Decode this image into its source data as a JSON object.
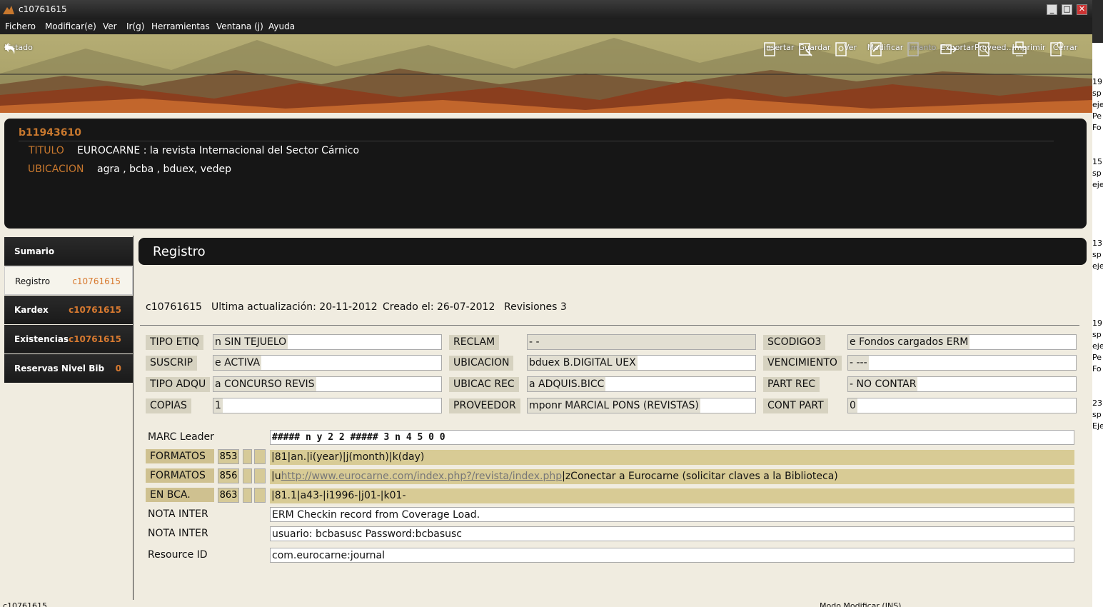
{
  "window": {
    "title": "c10761615"
  },
  "menu": [
    "Fichero",
    "Modificar(e)",
    "Ver",
    "Ir(g)",
    "Herramientas",
    "Ventana (j)",
    "Ayuda"
  ],
  "toolbar": {
    "listado": "Listado",
    "buttons": [
      {
        "label": "Insertar",
        "icon": "insert-icon",
        "enabled": true
      },
      {
        "label": "Guardar",
        "icon": "save-icon",
        "enabled": true
      },
      {
        "label": "Ver",
        "icon": "view-icon",
        "enabled": true
      },
      {
        "label": "Modificar",
        "icon": "edit-icon",
        "enabled": true
      },
      {
        "label": "Imanto",
        "icon": "disabled-icon",
        "enabled": false
      },
      {
        "label": "Exportar",
        "icon": "export-icon",
        "enabled": true
      },
      {
        "label": "Proveed...",
        "icon": "search-doc-icon",
        "enabled": true
      },
      {
        "label": "Imprimir",
        "icon": "print-icon",
        "enabled": true
      },
      {
        "label": "Cerrar",
        "icon": "close-doc-icon",
        "enabled": true
      }
    ]
  },
  "header": {
    "record_id": "b11943610",
    "titulo_label": "TITULO",
    "titulo_value": "EUROCARNE : la revista Internacional del Sector Cárnico",
    "ubicacion_label": "UBICACION",
    "ubicacion_value": "agra , bcba , bduex, vedep"
  },
  "sidebar": [
    {
      "label": "Sumario",
      "code": "",
      "active": false
    },
    {
      "label": "Registro",
      "code": "c10761615",
      "active": true
    },
    {
      "label": "Kardex",
      "code": "c10761615",
      "active": false
    },
    {
      "label": "Existencias",
      "code": "c10761615",
      "active": false
    },
    {
      "label": "Reservas Nivel Bib",
      "code": "0",
      "active": false
    }
  ],
  "section_title": "Registro",
  "record_info": {
    "id": "c10761615",
    "updated": "Ultima actualización: 20-11-2012",
    "created": "Creado el: 26-07-2012",
    "revisions": "Revisiones 3"
  },
  "fields": {
    "tipo_etiq": {
      "label": "TIPO ETIQ",
      "value": "n  SIN TEJUELO"
    },
    "suscrip": {
      "label": "SUSCRIP",
      "value": "e  ACTIVA"
    },
    "tipo_adqu": {
      "label": "TIPO ADQU",
      "value": "a  CONCURSO REVIS"
    },
    "copias": {
      "label": "COPIAS",
      "value": "1"
    },
    "reclam": {
      "label": "RECLAM",
      "value": "-  -"
    },
    "ubicacion": {
      "label": "UBICACION",
      "value": "bduex  B.DIGITAL UEX"
    },
    "ubicac_rec": {
      "label": "UBICAC REC",
      "value": "a  ADQUIS.BICC"
    },
    "proveedor": {
      "label": "PROVEEDOR",
      "value": "mponr  MARCIAL PONS (REVISTAS)"
    },
    "scodigo3": {
      "label": "SCODIGO3",
      "value": "e  Fondos cargados ERM"
    },
    "vencimiento": {
      "label": "VENCIMIENTO",
      "value": "-  ---"
    },
    "part_rec": {
      "label": "PART REC",
      "value": "-  NO CONTAR"
    },
    "cont_part": {
      "label": "CONT PART",
      "value": "0"
    }
  },
  "marc": {
    "leader_label": "MARC Leader",
    "leader_value": "##### n y    2 2 ##### 3 n   4 5 0 0",
    "rows": [
      {
        "label": "FORMATOS",
        "code": "853",
        "value": "|81|an.|i(year)|j(month)|k(day)"
      },
      {
        "label": "FORMATOS",
        "code": "856",
        "prefix": "|u",
        "link": "http://www.eurocarne.com/index.php?/revista/index.php",
        "suffix": "|zConectar a Eurocarne (solicitar claves a la Biblioteca)"
      },
      {
        "label": "EN BCA.",
        "code": "863",
        "value": "|81.1|a43-|i1996-|j01-|k01-"
      }
    ],
    "notes": [
      {
        "label": "NOTA INTER",
        "value": "ERM Checkin record from Coverage Load."
      },
      {
        "label": "NOTA INTER",
        "value": "usuario: bcbasusc Password:bcbasusc"
      },
      {
        "label": "Resource ID",
        "value": "com.eurocarne:journal"
      }
    ]
  },
  "status": {
    "left": "c10761615",
    "right": "Modo Modificar (INS)"
  },
  "background_window": [
    "19",
    "sp",
    "eje",
    "Pe",
    "Fo",
    "15",
    "sp",
    "eje",
    "13",
    "sp",
    "eje",
    "19",
    "sp",
    "eje",
    "Pe",
    "Fo",
    "23",
    "sp",
    "Eje"
  ]
}
